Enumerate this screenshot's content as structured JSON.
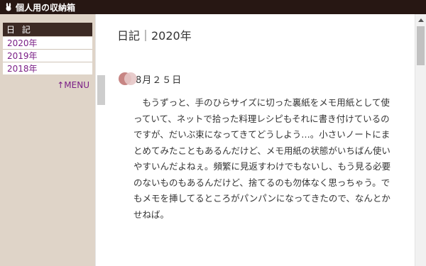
{
  "window": {
    "title": "個人用の収納箱"
  },
  "sidebar": {
    "heading": "日 記",
    "items": [
      {
        "label": "2020年"
      },
      {
        "label": "2019年"
      },
      {
        "label": "2018年"
      }
    ],
    "menu_link": "↑MENU"
  },
  "main": {
    "title": "日記｜2020年",
    "entry_date": "8月２５日",
    "entry_text": "もうずっと、手のひらサイズに切った裏紙をメモ用紙として使っていて、ネットで拾った料理レシピもそれに書き付けているのですが、だいぶ束になってきてどうしよう…。小さいノートにまとめてみたこともあるんだけど、メモ用紙の状態がいちばん使いやすいんだよねぇ。頻繁に見返すわけでもないし、もう見る必要のないものもあるんだけど、捨てるのも勿体なく思っちゃう。でもメモを挿してるところがパンパンになってきたので、なんとかせねば。"
  },
  "colors": {
    "topbar": "#271713",
    "sidebar_bg": "#dfd4c8",
    "sidebar_heading_bg": "#3c2a24",
    "link": "#7a1e86",
    "date_dot": "#c78583"
  }
}
